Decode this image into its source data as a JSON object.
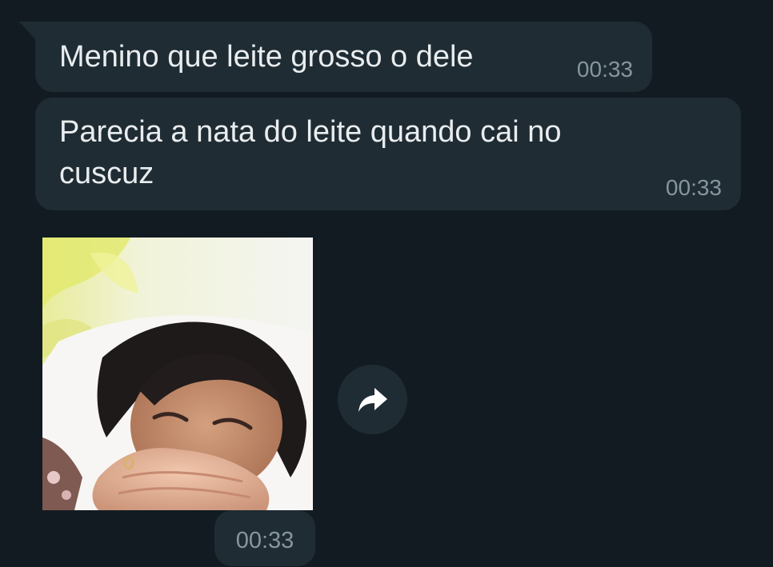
{
  "messages": [
    {
      "text": "Menino que leite grosso o dele",
      "time": "00:33"
    },
    {
      "text": "Parecia a nata do leite quando cai no\ncuscuz",
      "time": "00:33"
    }
  ],
  "media": {
    "type": "photo",
    "time": "00:33"
  },
  "icons": {
    "forward": "forward-arrow-icon"
  },
  "colors": {
    "background": "#121b22",
    "bubble": "#1f2c33",
    "text": "#e9edef",
    "timestamp": "#8696a0"
  }
}
